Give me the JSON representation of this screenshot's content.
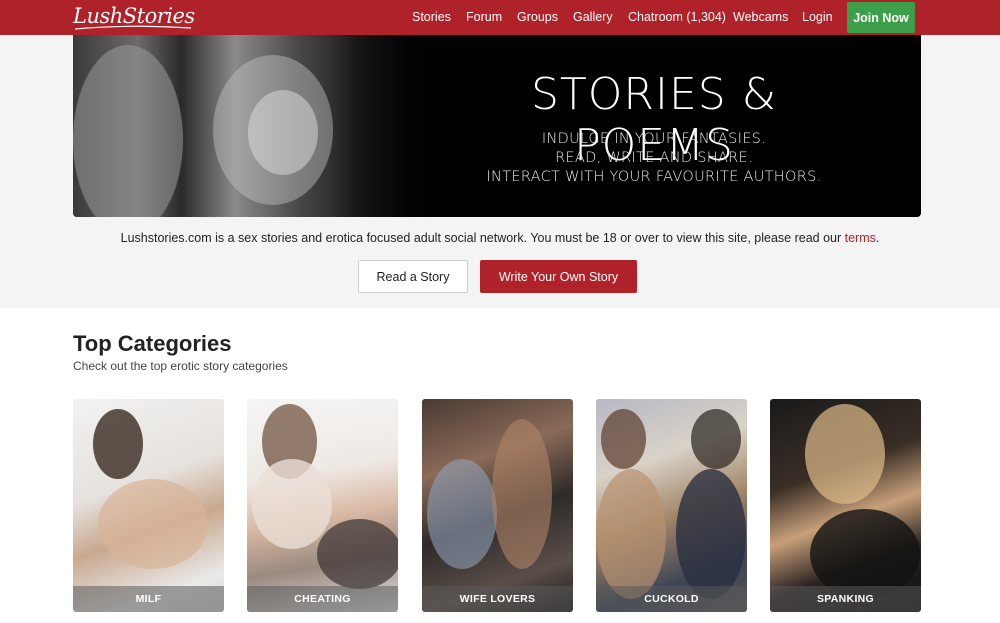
{
  "header": {
    "logo": "LushStories",
    "nav": [
      "Stories",
      "Forum",
      "Groups",
      "Gallery",
      "Chatroom (1,304)",
      "Webcams",
      "Login"
    ],
    "join_label": "Join Now"
  },
  "hero": {
    "title": "STORIES & POEMS",
    "lines": [
      "INDULGE IN YOUR FANTASIES.",
      "READ, WRITE AND SHARE.",
      "INTERACT WITH YOUR FAVOURITE AUTHORS."
    ],
    "intro_text": "Lushstories.com is a sex stories and erotica focused adult social network. You must be 18 or over to view this site, please read our ",
    "intro_link": "terms",
    "intro_end": ".",
    "read_button": "Read a Story",
    "write_button": "Write Your Own Story"
  },
  "categories": {
    "title": "Top Categories",
    "subtitle": "Check out the top erotic story categories",
    "items": [
      "MILF",
      "CHEATING",
      "WIFE LOVERS",
      "CUCKOLD",
      "SPANKING"
    ]
  },
  "colors": {
    "brand_red": "#b0222a",
    "join_green": "#3e9f4a"
  }
}
